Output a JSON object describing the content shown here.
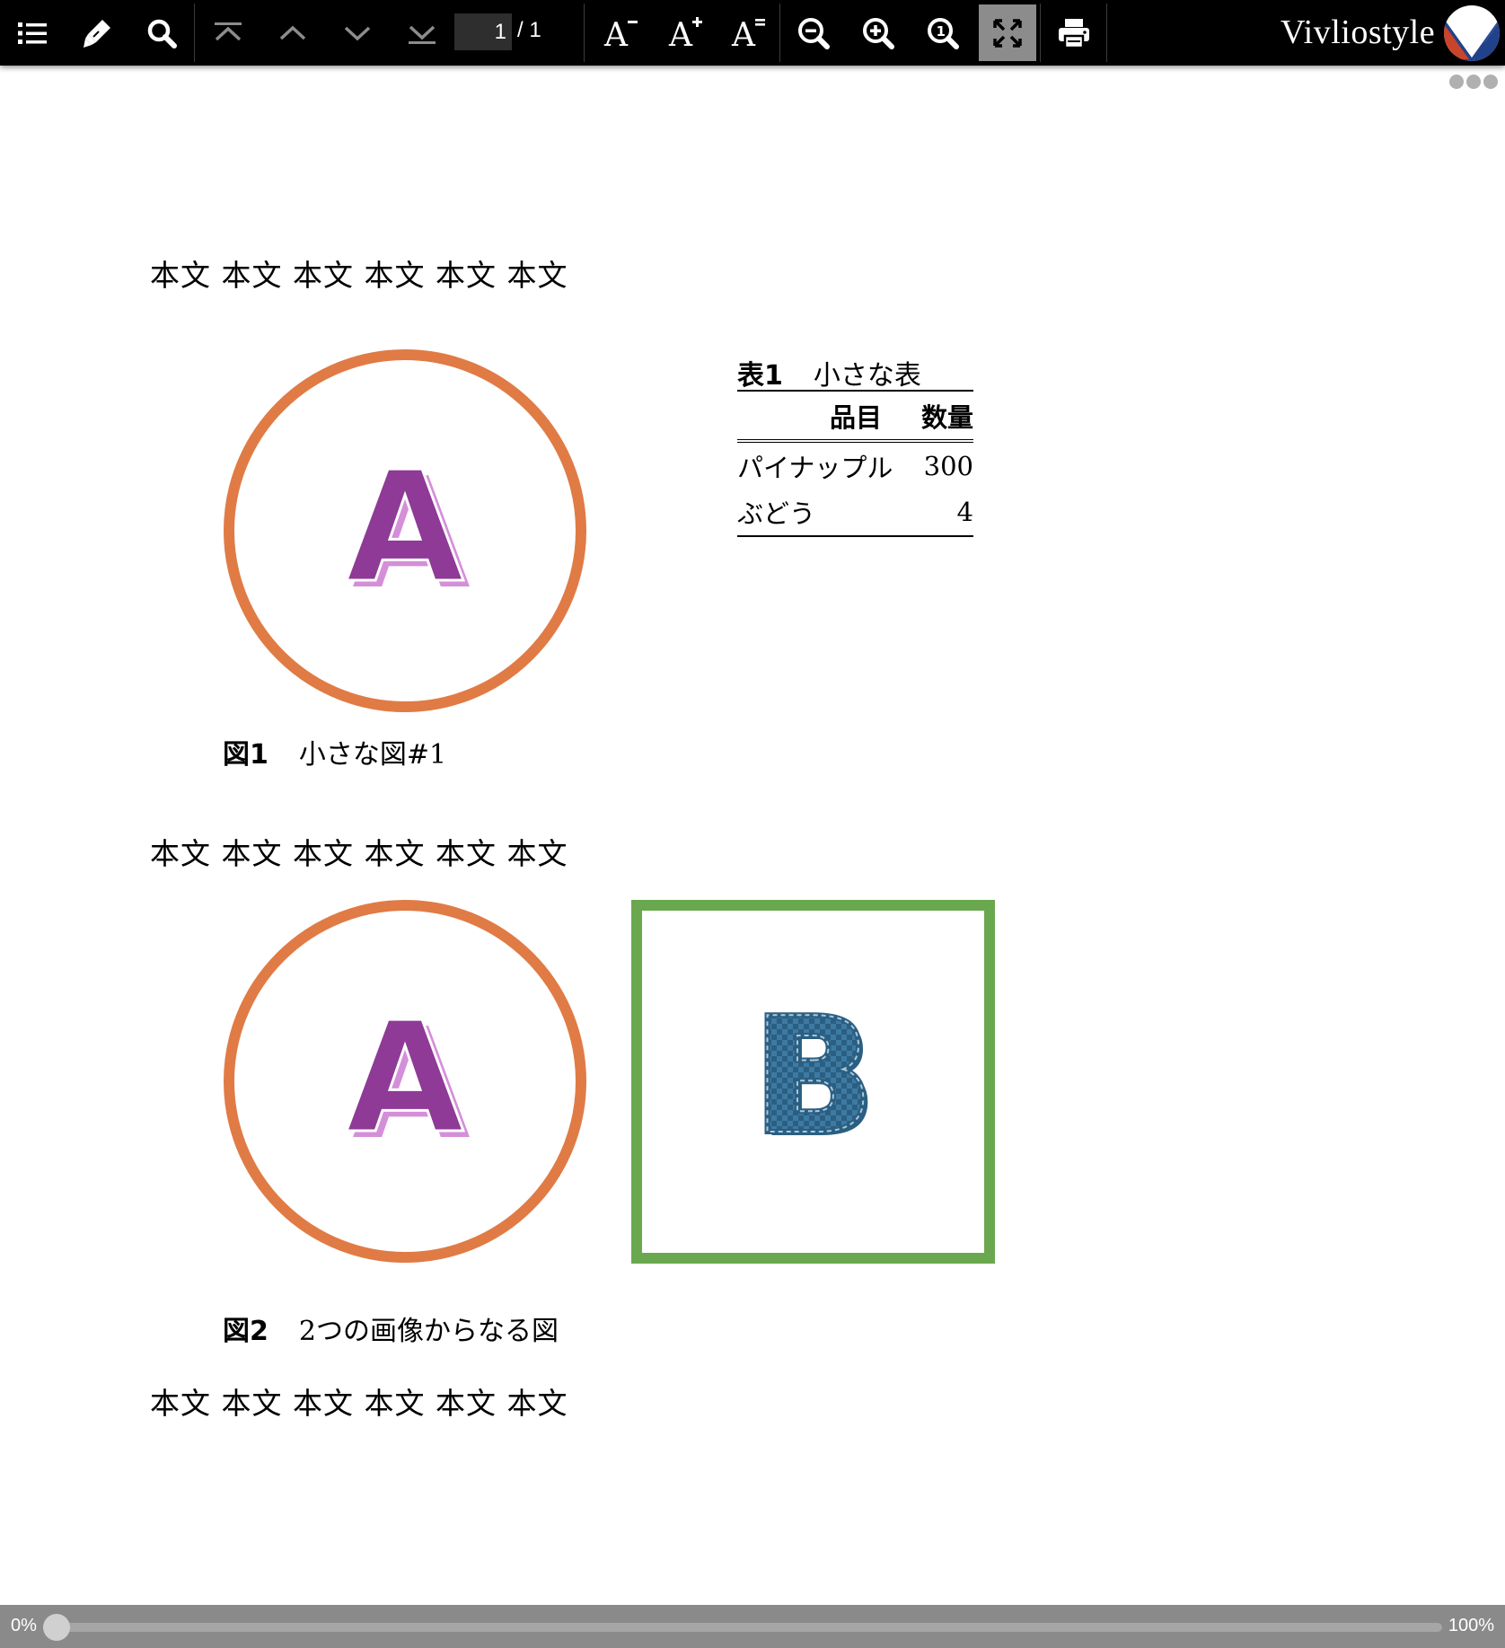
{
  "toolbar": {
    "page_current": "1",
    "page_total": "/ 1",
    "brand": "Vivliostyle",
    "buttons": [
      {
        "name": "toc-button",
        "icon": "list-icon"
      },
      {
        "name": "marker-button",
        "icon": "marker-icon"
      },
      {
        "name": "search-button",
        "icon": "search-icon"
      },
      {
        "name": "first-page-button",
        "icon": "first-page-icon"
      },
      {
        "name": "previous-page-button",
        "icon": "chevron-up-icon"
      },
      {
        "name": "next-page-button",
        "icon": "chevron-down-icon"
      },
      {
        "name": "last-page-button",
        "icon": "last-page-icon"
      },
      {
        "name": "font-size-decrease-button",
        "icon": "font-decrease-icon"
      },
      {
        "name": "font-size-increase-button",
        "icon": "font-increase-icon"
      },
      {
        "name": "font-size-reset-button",
        "icon": "font-reset-icon"
      },
      {
        "name": "zoom-out-button",
        "icon": "zoom-out-icon"
      },
      {
        "name": "zoom-in-button",
        "icon": "zoom-in-icon"
      },
      {
        "name": "zoom-actual-size-button",
        "icon": "zoom-actual-icon"
      },
      {
        "name": "fit-to-screen-button",
        "icon": "fit-screen-icon",
        "active": true
      },
      {
        "name": "print-button",
        "icon": "print-icon"
      }
    ]
  },
  "document": {
    "paragraphs": [
      "本文 本文 本文 本文 本文 本文",
      "本文 本文 本文 本文 本文 本文",
      "本文 本文 本文 本文 本文 本文"
    ],
    "figure1": {
      "label": "図1",
      "caption": "小さな図#1",
      "image_letter": "A"
    },
    "figure2": {
      "label": "図2",
      "caption": "2つの画像からなる図",
      "image_letters": [
        "A",
        "B"
      ]
    },
    "table1": {
      "label": "表1",
      "caption": "小さな表",
      "headers": [
        "品目",
        "数量"
      ],
      "rows": [
        [
          "パイナップル",
          "300"
        ],
        [
          "ぶどう",
          "4"
        ]
      ]
    }
  },
  "progress": {
    "min_label": "0%",
    "max_label": "100%",
    "value": 0
  },
  "colors": {
    "circle_stroke": "#e07b45",
    "square_stroke": "#6aa84f",
    "letter_a": "#8e3a96",
    "letter_a_shadow": "#d48fd8",
    "letter_b": "#2b5f82"
  }
}
